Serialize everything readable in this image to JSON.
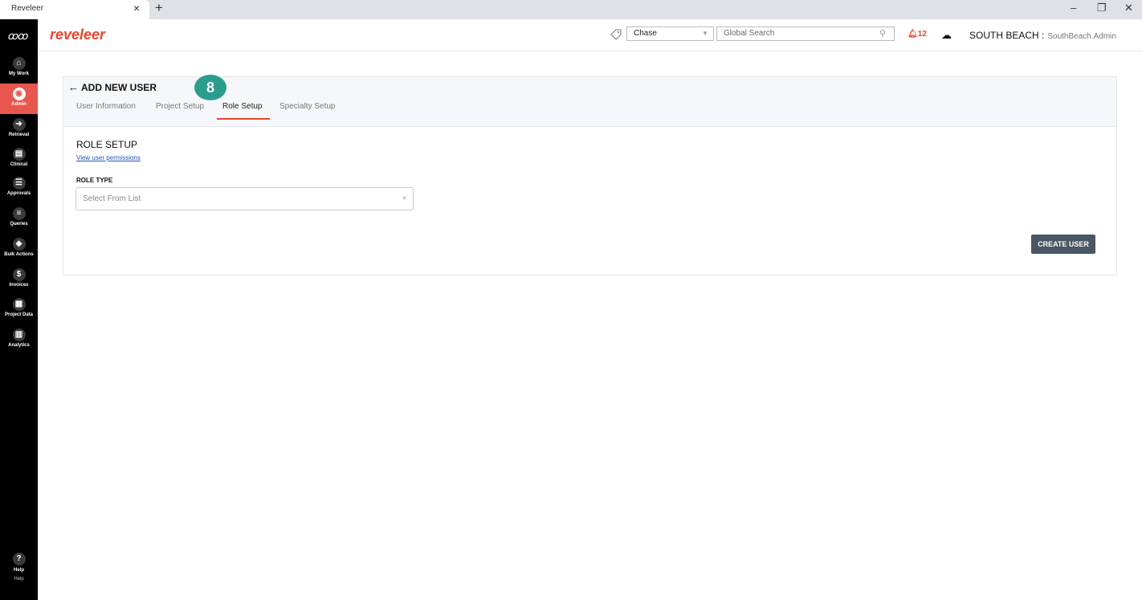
{
  "browser": {
    "tab_title": "Reveleer",
    "tab_close": "×",
    "new_tab": "+",
    "minimize": "–",
    "restore": "❐",
    "close": "✕"
  },
  "brand": {
    "logo_mark": "ꝏꝏ",
    "name": "reveleer"
  },
  "nav": {
    "items": [
      {
        "label": "My Work",
        "icon": "home-icon",
        "glyph": "⌂"
      },
      {
        "label": "Admin",
        "icon": "admin-icon",
        "glyph": "◉"
      },
      {
        "label": "Retrieval",
        "icon": "retrieval-icon",
        "glyph": "➔"
      },
      {
        "label": "Clinical",
        "icon": "clinical-icon",
        "glyph": "▤"
      },
      {
        "label": "Approvals",
        "icon": "approvals-icon",
        "glyph": "☰"
      },
      {
        "label": "Queries",
        "icon": "queries-icon",
        "glyph": "≡"
      },
      {
        "label": "Bulk Actions",
        "icon": "bulk-actions-icon",
        "glyph": "◈"
      },
      {
        "label": "Invoices",
        "icon": "invoices-icon",
        "glyph": "$"
      },
      {
        "label": "Project Data",
        "icon": "project-data-icon",
        "glyph": "▦"
      },
      {
        "label": "Analytics",
        "icon": "analytics-icon",
        "glyph": "▥"
      }
    ],
    "active": "Admin",
    "help": {
      "glyph": "?",
      "label": "Help",
      "label2": "Help"
    }
  },
  "header": {
    "project_select": "Chase",
    "search_placeholder": "Global Search",
    "notifications": "12",
    "org": "SOUTH BEACH :",
    "user": "SouthBeach.Admin"
  },
  "page": {
    "back": "←",
    "title": "ADD NEW USER",
    "tabs": [
      {
        "label": "User Information"
      },
      {
        "label": "Project Setup"
      },
      {
        "label": "Role Setup"
      },
      {
        "label": "Specialty Setup"
      }
    ],
    "active_tab": "Role Setup",
    "step_badge": "8",
    "section_title": "ROLE SETUP",
    "permissions_link": "View user permissions",
    "role_type_label": "ROLE TYPE",
    "role_type_placeholder": "Select From List",
    "create_button": "CREATE USER"
  },
  "colors": {
    "accent": "#e8452c",
    "nav_bg": "#000000",
    "badge": "#2a9d8f",
    "button": "#4a5664"
  }
}
